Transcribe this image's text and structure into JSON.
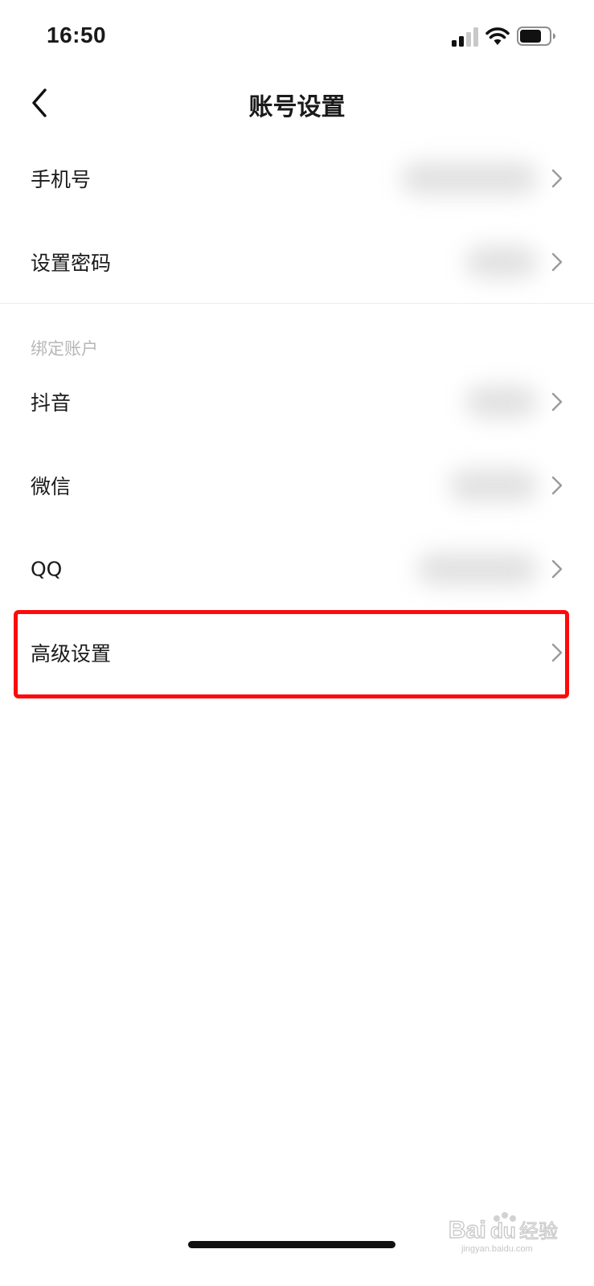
{
  "status_bar": {
    "time": "16:50",
    "icons": [
      "signal-icon",
      "wifi-icon",
      "battery-icon"
    ]
  },
  "nav": {
    "title": "账号设置",
    "back_icon": "chevron-left-icon"
  },
  "account": {
    "items": [
      {
        "label": "手机号"
      },
      {
        "label": "设置密码"
      }
    ]
  },
  "bound_accounts": {
    "header": "绑定账户",
    "items": [
      {
        "label": "抖音"
      },
      {
        "label": "微信"
      },
      {
        "label": "QQ"
      }
    ]
  },
  "advanced": {
    "label": "高级设置"
  },
  "watermark": {
    "logo_text": "Baidu经验",
    "url": "jingyan.baidu.com"
  },
  "colors": {
    "highlight": "#ff0a0a",
    "section_header": "#b7b7b7",
    "chevron": "#9a9a9a"
  }
}
